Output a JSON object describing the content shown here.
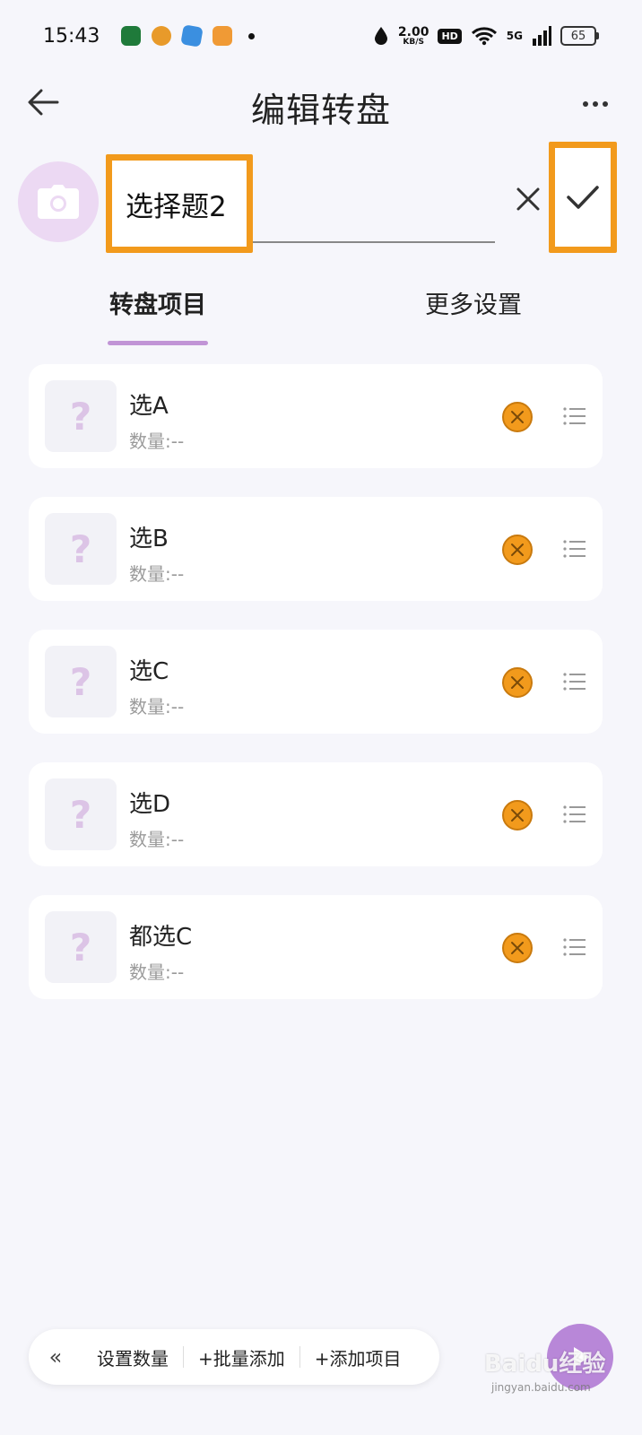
{
  "status_bar": {
    "time": "15:43",
    "net_speed_value": "2.00",
    "net_speed_unit": "KB/S",
    "hd": "HD",
    "network": "5G",
    "battery": "65"
  },
  "header": {
    "title": "编辑转盘"
  },
  "name_row": {
    "value": "选择题2"
  },
  "tabs": [
    {
      "label": "转盘项目",
      "active": true
    },
    {
      "label": "更多设置",
      "active": false
    }
  ],
  "items": [
    {
      "label": "选A",
      "qty": "数量:--",
      "thumb": "?"
    },
    {
      "label": "选B",
      "qty": "数量:--",
      "thumb": "?"
    },
    {
      "label": "选C",
      "qty": "数量:--",
      "thumb": "?"
    },
    {
      "label": "选D",
      "qty": "数量:--",
      "thumb": "?"
    },
    {
      "label": "都选C",
      "qty": "数量:--",
      "thumb": "?"
    }
  ],
  "toolbar": {
    "collapse": "«",
    "set_qty": "设置数量",
    "batch_add": "+批量添加",
    "add_item": "+添加项目"
  },
  "watermark": {
    "main": "Baidu经验",
    "sub": "jingyan.baidu.com"
  },
  "colors": {
    "highlight": "#f29a1c",
    "accent": "#c194d6",
    "background": "#f6f6fb"
  }
}
